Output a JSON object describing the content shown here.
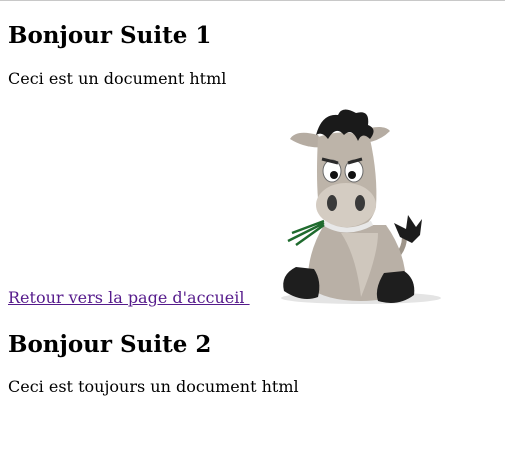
{
  "section1": {
    "title": "Bonjour Suite 1",
    "text": "Ceci est un document html"
  },
  "link": {
    "label": "Retour vers la page d'accueil "
  },
  "image": {
    "icon": "donkey-mascot-icon"
  },
  "section2": {
    "title": "Bonjour Suite 2",
    "text": "Ceci est toujours un document html"
  },
  "colors": {
    "link_visited": "#551a8b",
    "text": "#000000",
    "background": "#ffffff"
  }
}
